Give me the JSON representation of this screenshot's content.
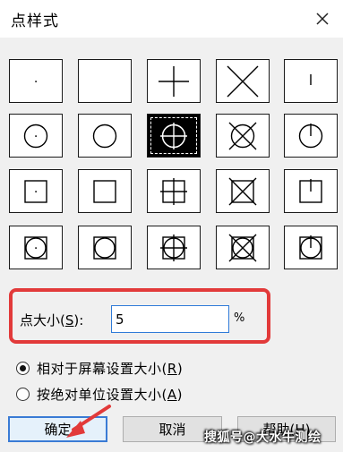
{
  "window": {
    "title": "点样式"
  },
  "point_styles": [
    {
      "id": "dot"
    },
    {
      "id": "none"
    },
    {
      "id": "plus"
    },
    {
      "id": "x"
    },
    {
      "id": "tick"
    },
    {
      "id": "circle-dot"
    },
    {
      "id": "circle"
    },
    {
      "id": "circle-plus",
      "selected": true
    },
    {
      "id": "circle-x"
    },
    {
      "id": "circle-tick"
    },
    {
      "id": "square-dot"
    },
    {
      "id": "square"
    },
    {
      "id": "square-plus"
    },
    {
      "id": "square-x"
    },
    {
      "id": "square-tick"
    },
    {
      "id": "square-circle-dot"
    },
    {
      "id": "square-circle"
    },
    {
      "id": "square-circle-plus"
    },
    {
      "id": "square-circle-x"
    },
    {
      "id": "square-circle-tick"
    }
  ],
  "point_size": {
    "label": "点大小",
    "label_open": "(",
    "accel": "S",
    "label_close": "):",
    "value": "5",
    "unit": "%"
  },
  "size_mode": {
    "relative": {
      "text": "相对于屏幕设置大小",
      "accel_open": "(",
      "accel": "R",
      "accel_close": ")",
      "checked": true
    },
    "absolute": {
      "text": "按绝对单位设置大小",
      "accel_open": "(",
      "accel": "A",
      "accel_close": ")",
      "checked": false
    }
  },
  "buttons": {
    "ok": "确定",
    "cancel": "取消",
    "help": "帮助(H)"
  },
  "watermark": "搜狐号@大水牛测绘",
  "colors": {
    "highlight": "#e23a3a",
    "accent": "#3a7bd5"
  }
}
